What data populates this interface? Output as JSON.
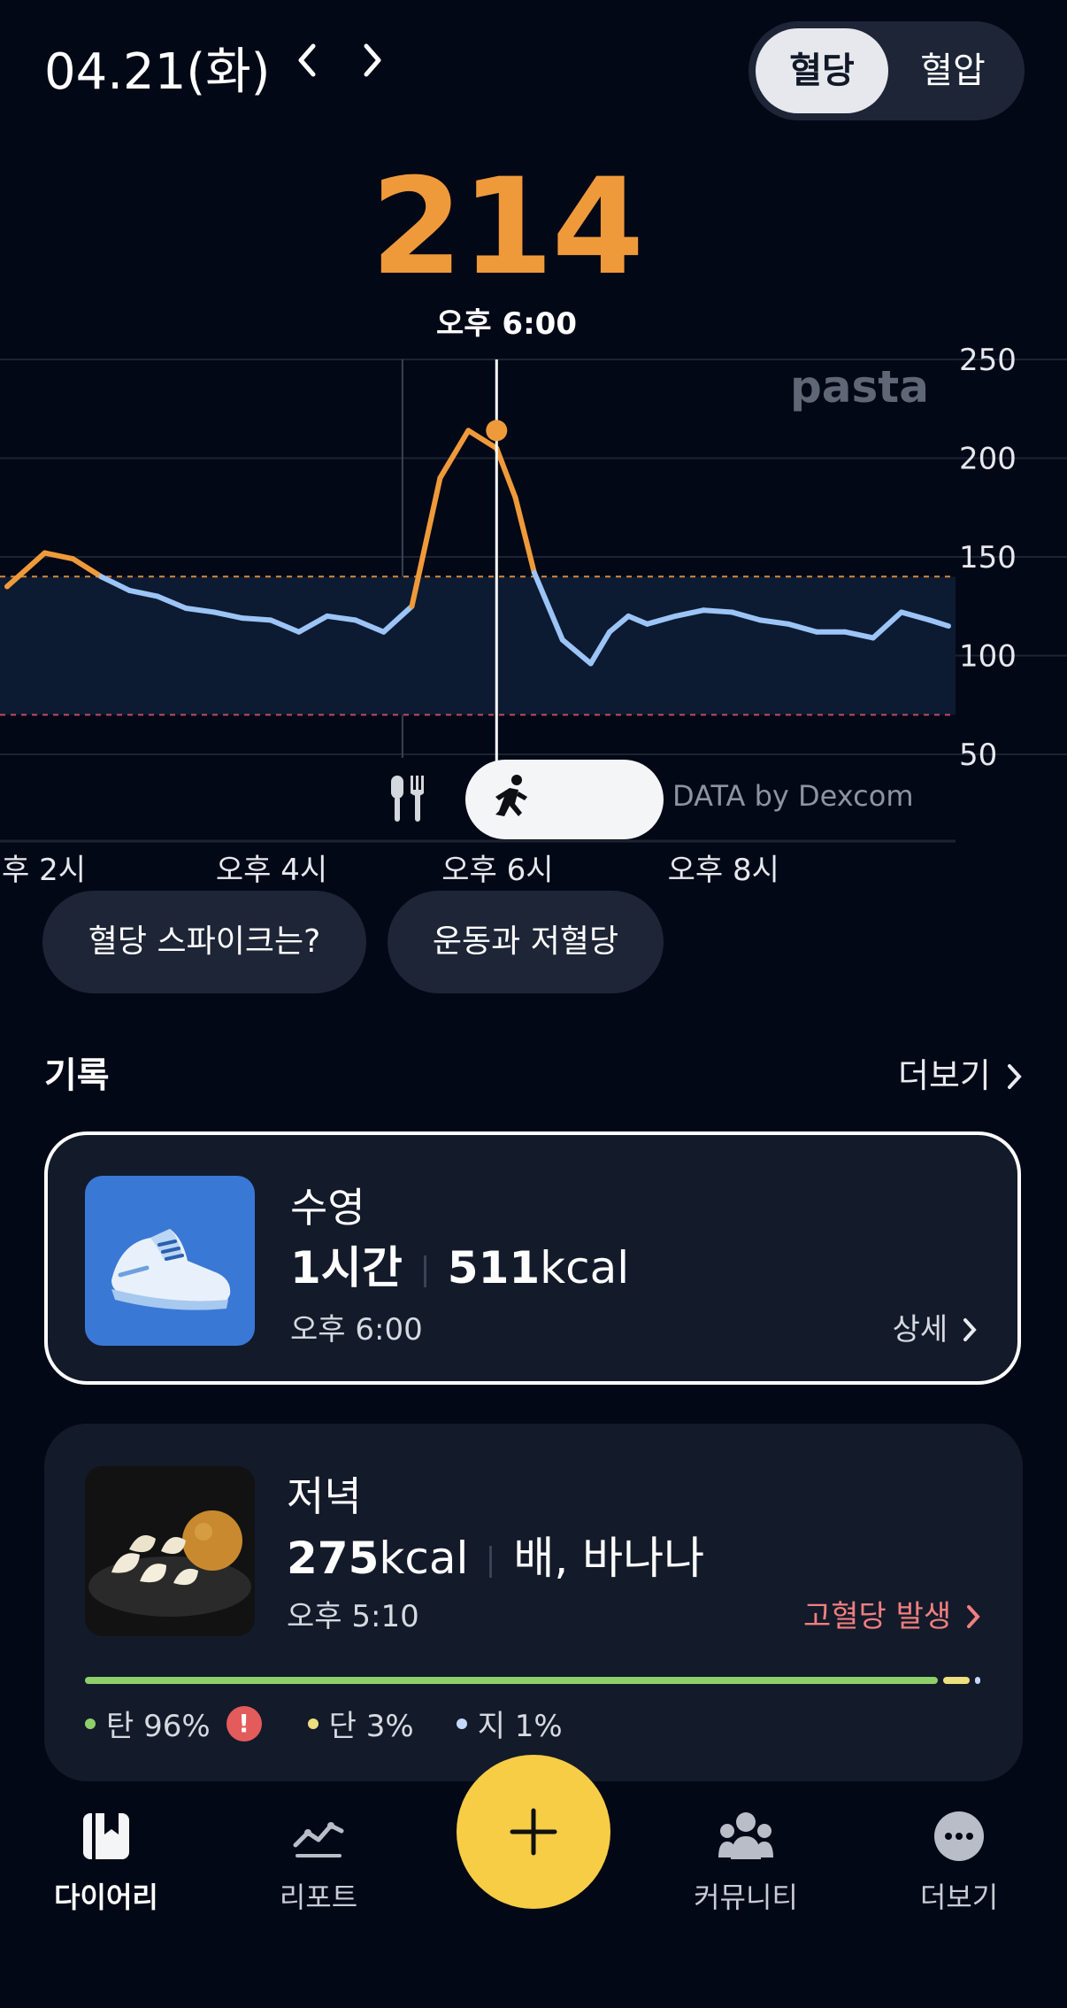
{
  "header": {
    "date": "04.21(화)",
    "segments": [
      "혈당",
      "혈압"
    ],
    "active_segment": "혈당"
  },
  "reading": {
    "value": "214",
    "time": "오후 6:00"
  },
  "chart": {
    "y_ticks": [
      "250",
      "200",
      "150",
      "100",
      "50"
    ],
    "x_ticks": [
      "후 2시",
      "오후 4시",
      "오후 6시",
      "오후 8시"
    ],
    "watermark": "pasta",
    "source": "DATA by Dexcom",
    "highlight_color": "#ef9a3a",
    "normal_color": "#9cc4f6"
  },
  "chart_data": {
    "type": "line",
    "x": [
      "13:40",
      "14:00",
      "14:15",
      "14:30",
      "14:45",
      "15:00",
      "15:15",
      "15:30",
      "15:45",
      "16:00",
      "16:15",
      "16:30",
      "16:45",
      "17:00",
      "17:15",
      "17:30",
      "17:45",
      "18:00",
      "18:10",
      "18:20",
      "18:35",
      "18:50",
      "19:00",
      "19:10",
      "19:20",
      "19:35",
      "19:50",
      "20:05",
      "20:20",
      "20:35",
      "20:50",
      "21:05",
      "21:20",
      "21:35",
      "21:50",
      "22:00"
    ],
    "series": [
      {
        "values": [
          135,
          152,
          149,
          140,
          133,
          130,
          124,
          122,
          119,
          118,
          112,
          120,
          118,
          112,
          125,
          190,
          214,
          205,
          180,
          142,
          108,
          96,
          112,
          120,
          116,
          120,
          123,
          122,
          118,
          116,
          112,
          112,
          109,
          122,
          118,
          115
        ]
      }
    ],
    "ylim": [
      50,
      250
    ],
    "reference_lines": [
      140,
      70
    ],
    "selected": {
      "x": "18:00",
      "y": 214
    }
  },
  "quick_chips": [
    "혈당 스파이크는?",
    "운동과 저혈당"
  ],
  "records": {
    "title": "기록",
    "more_label": "더보기",
    "items": [
      {
        "title": "수영",
        "duration": "1시간",
        "kcal_num": "511",
        "kcal_unit": "kcal",
        "time": "오후 6:00",
        "link": "상세",
        "icon": "running-shoe-icon"
      },
      {
        "title": "저녁",
        "kcal_num": "275",
        "kcal_unit": "kcal",
        "foods": "배, 바나나",
        "time": "오후 5:10",
        "alert": "고혈당 발생",
        "alert_color": "#f07f7f",
        "macros": [
          {
            "label": "탄 96%",
            "value": 96,
            "color": "#8fcf6a"
          },
          {
            "label": "단 3%",
            "value": 3,
            "color": "#eedf7f"
          },
          {
            "label": "지 1%",
            "value": 1,
            "color": "#c4d9f8"
          }
        ]
      }
    ]
  },
  "bottom_nav": [
    "다이어리",
    "리포트",
    "커뮤니티",
    "더보기"
  ]
}
